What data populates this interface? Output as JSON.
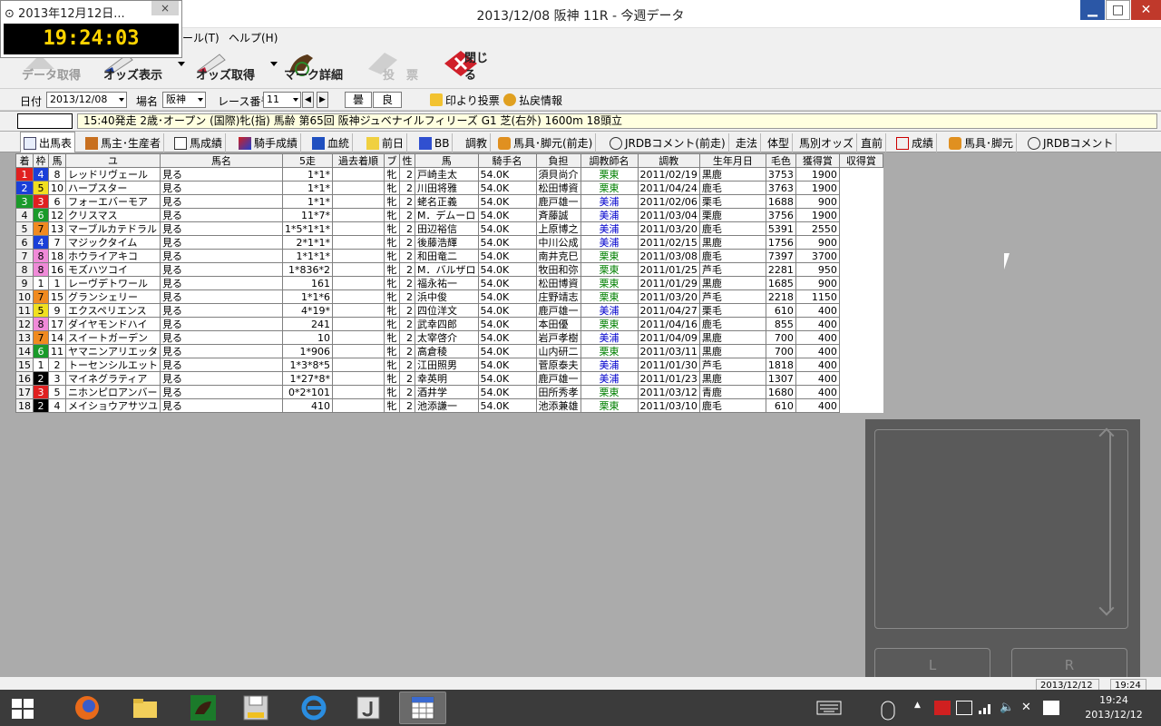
{
  "window": {
    "title": "2013/12/08 阪神 11R - 今週データ"
  },
  "clock": {
    "title": "2013年12月12日...",
    "close": "×",
    "time": "19:24:03"
  },
  "menu": {
    "tool": "ール(T)",
    "help": "ヘルプ(H)"
  },
  "toolbar": {
    "data_get": "データ取得",
    "odds_show": "オッズ表示",
    "odds_get": "オッズ取得",
    "mark_detail": "マーク詳細",
    "vote": "投　票",
    "close": "閉じる"
  },
  "criteria": {
    "date_label": "日付",
    "date_value": "2013/12/08",
    "venue_label": "場名",
    "venue_value": "阪神",
    "race_label": "レース番号",
    "race_value": "11",
    "prev": "◀",
    "next": "▶",
    "weather": "曇",
    "track": "良",
    "mark_vote": "印より投票",
    "payout": "払戻情報"
  },
  "race_info": "15:40発走 2歳･オープン (国際)牝(指) 馬齢 第65回 阪神ジュベナイルフィリーズ G1 芝(右外) 1600m 18頭立",
  "tabs": [
    "出馬表",
    "馬主･生産者",
    "馬成績",
    "騎手成績",
    "血統",
    "前日",
    "BB",
    "調教",
    "馬具･脚元(前走)",
    "JRDBコメント(前走)",
    "走法",
    "体型",
    "馬別オッズ",
    "直前",
    "成績",
    "馬具･脚元",
    "JRDBコメント"
  ],
  "colors": {
    "accent": "#2b57a6",
    "info_bg": "#ffffe0",
    "east": "#008000",
    "west": "#0000cc"
  },
  "table": {
    "headers": [
      "着",
      "枠",
      "馬",
      "ユ",
      "馬名",
      "5走",
      "過去着順",
      "ブ",
      "性",
      "馬",
      "騎手名",
      "負担",
      "調教師名",
      "調教",
      "生年月日",
      "毛色",
      "獲得賞",
      "収得賞"
    ],
    "rows": [
      {
        "waku": "1",
        "uma": "4",
        "yu": "8",
        "name": "レッドリヴェール",
        "go": "見る",
        "past": "1*1*",
        "sex": "牝",
        "age": "2",
        "jockey": "戸崎圭太",
        "weight": "54.0K",
        "trainer": "須貝尚介",
        "stable": "栗東",
        "birth": "2011/02/19",
        "color": "黒鹿",
        "prize": "3753",
        "earn": "1900"
      },
      {
        "waku": "2",
        "uma": "5",
        "yu": "10",
        "name": "ハープスター",
        "go": "見る",
        "past": "1*1*",
        "sex": "牝",
        "age": "2",
        "jockey": "川田将雅",
        "weight": "54.0K",
        "trainer": "松田博資",
        "stable": "栗東",
        "birth": "2011/04/24",
        "color": "鹿毛",
        "prize": "3763",
        "earn": "1900"
      },
      {
        "waku": "3",
        "uma": "3",
        "yu": "6",
        "name": "フォーエバーモア",
        "go": "見る",
        "past": "1*1*",
        "sex": "牝",
        "age": "2",
        "jockey": "蛯名正義",
        "weight": "54.0K",
        "trainer": "鹿戸雄一",
        "stable": "美浦",
        "birth": "2011/02/06",
        "color": "栗毛",
        "prize": "1688",
        "earn": "900"
      },
      {
        "waku": "4",
        "uma": "6",
        "yu": "12",
        "name": "クリスマス",
        "go": "見る",
        "past": "11*7*",
        "sex": "牝",
        "age": "2",
        "jockey": "M．デムーロ",
        "weight": "54.0K",
        "trainer": "斉藤誠",
        "stable": "美浦",
        "birth": "2011/03/04",
        "color": "栗鹿",
        "prize": "3756",
        "earn": "1900"
      },
      {
        "waku": "5",
        "uma": "7",
        "yu": "13",
        "name": "マーブルカテドラル",
        "go": "見る",
        "past": "1*5*1*1*",
        "sex": "牝",
        "age": "2",
        "jockey": "田辺裕信",
        "weight": "54.0K",
        "trainer": "上原博之",
        "stable": "美浦",
        "birth": "2011/03/20",
        "color": "鹿毛",
        "prize": "5391",
        "earn": "2550"
      },
      {
        "waku": "6",
        "uma": "4",
        "yu": "7",
        "name": "マジックタイム",
        "go": "見る",
        "past": "2*1*1*",
        "sex": "牝",
        "age": "2",
        "jockey": "後藤浩輝",
        "weight": "54.0K",
        "trainer": "中川公成",
        "stable": "美浦",
        "birth": "2011/02/15",
        "color": "黒鹿",
        "prize": "1756",
        "earn": "900"
      },
      {
        "waku": "7",
        "uma": "8",
        "yu": "18",
        "name": "ホウライアキコ",
        "go": "見る",
        "past": "1*1*1*",
        "sex": "牝",
        "age": "2",
        "jockey": "和田竜二",
        "weight": "54.0K",
        "trainer": "南井克巳",
        "stable": "栗東",
        "birth": "2011/03/08",
        "color": "鹿毛",
        "prize": "7397",
        "earn": "3700"
      },
      {
        "waku": "8",
        "uma": "8",
        "yu": "16",
        "name": "モズハツコイ",
        "go": "見る",
        "past": "1*836*2",
        "sex": "牝",
        "age": "2",
        "jockey": "M．バルザロ",
        "weight": "54.0K",
        "trainer": "牧田和弥",
        "stable": "栗東",
        "birth": "2011/01/25",
        "color": "芦毛",
        "prize": "2281",
        "earn": "950"
      },
      {
        "waku": "9",
        "uma": "1",
        "yu": "1",
        "name": "レーヴデトワール",
        "go": "見る",
        "past": "161",
        "sex": "牝",
        "age": "2",
        "jockey": "福永祐一",
        "weight": "54.0K",
        "trainer": "松田博資",
        "stable": "栗東",
        "birth": "2011/01/29",
        "color": "黒鹿",
        "prize": "1685",
        "earn": "900"
      },
      {
        "waku": "10",
        "uma": "7",
        "yu": "15",
        "name": "グランシェリー",
        "go": "見る",
        "past": "1*1*6",
        "sex": "牝",
        "age": "2",
        "jockey": "浜中俊",
        "weight": "54.0K",
        "trainer": "庄野靖志",
        "stable": "栗東",
        "birth": "2011/03/20",
        "color": "芦毛",
        "prize": "2218",
        "earn": "1150"
      },
      {
        "waku": "11",
        "uma": "5",
        "yu": "9",
        "name": "エクスペリエンス",
        "go": "見る",
        "past": "4*19*",
        "sex": "牝",
        "age": "2",
        "jockey": "四位洋文",
        "weight": "54.0K",
        "trainer": "鹿戸雄一",
        "stable": "美浦",
        "birth": "2011/04/27",
        "color": "栗毛",
        "prize": "610",
        "earn": "400"
      },
      {
        "waku": "12",
        "uma": "8",
        "yu": "17",
        "name": "ダイヤモンドハイ",
        "go": "見る",
        "past": "241",
        "sex": "牝",
        "age": "2",
        "jockey": "武幸四郎",
        "weight": "54.0K",
        "trainer": "本田優",
        "stable": "栗東",
        "birth": "2011/04/16",
        "color": "鹿毛",
        "prize": "855",
        "earn": "400"
      },
      {
        "waku": "13",
        "uma": "7",
        "yu": "14",
        "name": "スイートガーデン",
        "go": "見る",
        "past": "10",
        "sex": "牝",
        "age": "2",
        "jockey": "太宰啓介",
        "weight": "54.0K",
        "trainer": "岩戸孝樹",
        "stable": "美浦",
        "birth": "2011/04/09",
        "color": "黒鹿",
        "prize": "700",
        "earn": "400"
      },
      {
        "waku": "14",
        "uma": "6",
        "yu": "11",
        "name": "ヤマニンアリエッタ",
        "go": "見る",
        "past": "1*906",
        "sex": "牝",
        "age": "2",
        "jockey": "高倉稜",
        "weight": "54.0K",
        "trainer": "山内研二",
        "stable": "栗東",
        "birth": "2011/03/11",
        "color": "黒鹿",
        "prize": "700",
        "earn": "400"
      },
      {
        "waku": "15",
        "uma": "1",
        "yu": "2",
        "name": "トーセンシルエット",
        "go": "見る",
        "past": "1*3*8*5",
        "sex": "牝",
        "age": "2",
        "jockey": "江田照男",
        "weight": "54.0K",
        "trainer": "菅原泰夫",
        "stable": "美浦",
        "birth": "2011/01/30",
        "color": "芦毛",
        "prize": "1818",
        "earn": "400"
      },
      {
        "waku": "16",
        "uma": "2",
        "yu": "3",
        "name": "マイネグラティア",
        "go": "見る",
        "past": "1*27*8*",
        "sex": "牝",
        "age": "2",
        "jockey": "幸英明",
        "weight": "54.0K",
        "trainer": "鹿戸雄一",
        "stable": "美浦",
        "birth": "2011/01/23",
        "color": "黒鹿",
        "prize": "1307",
        "earn": "400"
      },
      {
        "waku": "17",
        "uma": "3",
        "yu": "5",
        "name": "ニホンピロアンバー",
        "go": "見る",
        "past": "0*2*101",
        "sex": "牝",
        "age": "2",
        "jockey": "酒井学",
        "weight": "54.0K",
        "trainer": "田所秀孝",
        "stable": "栗東",
        "birth": "2011/03/12",
        "color": "青鹿",
        "prize": "1680",
        "earn": "400"
      },
      {
        "waku": "18",
        "uma": "2",
        "yu": "4",
        "name": "メイショウアサツユ",
        "go": "見る",
        "past": "410",
        "sex": "牝",
        "age": "2",
        "jockey": "池添謙一",
        "weight": "54.0K",
        "trainer": "池添兼雄",
        "stable": "栗東",
        "birth": "2011/03/10",
        "color": "鹿毛",
        "prize": "610",
        "earn": "400"
      }
    ]
  },
  "touchpad": {
    "left": "L",
    "right": "R"
  },
  "status": {
    "date": "2013/12/12",
    "time": "19:24"
  },
  "taskbar": {
    "time": "19:24",
    "date": "2013/12/12"
  }
}
